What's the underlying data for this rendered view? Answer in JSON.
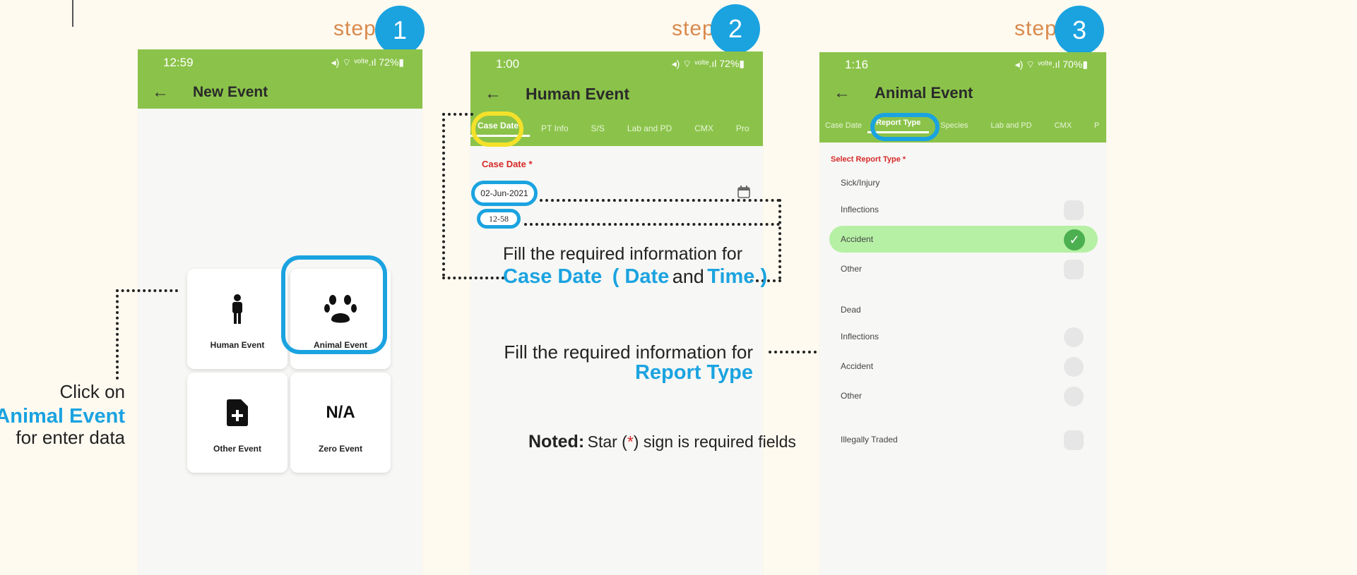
{
  "steps": [
    {
      "word": "step",
      "num": "1"
    },
    {
      "word": "step",
      "num": "2"
    },
    {
      "word": "step",
      "num": "3"
    }
  ],
  "phone1": {
    "time": "12:59",
    "status_right": "◂) ⌔ ᵛᵒˡᵗᵉ.ıl 72%▮",
    "back": "←",
    "title": "New Event",
    "tiles": [
      {
        "label": "Human Event",
        "icon": "person-icon",
        "glyph": "🯅"
      },
      {
        "label": "Animal Event",
        "icon": "paw-icon",
        "glyph": "🐾"
      },
      {
        "label": "Other Event",
        "icon": "add-file-icon",
        "glyph": "📄"
      },
      {
        "label": "Zero Event",
        "icon": "na-icon",
        "glyph": "N/A"
      }
    ]
  },
  "phone2": {
    "time": "1:00",
    "status_right": "◂) ⌔ ᵛᵒˡᵗᵉ.ıl 72%▮",
    "back": "←",
    "title": "Human Event",
    "tabs": [
      "Case Date",
      "PT Info",
      "S/S",
      "Lab and PD",
      "CMX",
      "Pro"
    ],
    "field_label": "Case Date *",
    "date_value": "02-Jun-2021",
    "time_value": "12-58",
    "calendar_icon": "calendar-icon"
  },
  "phone3": {
    "time": "1:16",
    "status_right": "◂) ⌔ ᵛᵒˡᵗᵉ.ıl 70%▮",
    "back": "←",
    "title": "Animal Event",
    "tabs": [
      "Case Date",
      "Report Type",
      "Species",
      "Lab and PD",
      "CMX",
      "P"
    ],
    "field_label": "Select Report Type *",
    "items": [
      "Sick/Injury",
      "Inflections",
      "Accident",
      "Other",
      "Dead",
      "Inflections",
      "Accident",
      "Other",
      "Illegally Traded"
    ]
  },
  "annotations": {
    "click_on": "Click on",
    "animal_event": "Animal Event",
    "for_enter_data": "for enter data",
    "fill_required_1": "Fill the required information for",
    "case_date": "Case Date",
    "paren_open": "( Date",
    "and": "and",
    "time_close": "Time )",
    "fill_required_2": "Fill the required information for",
    "report_type": "Report Type",
    "noted_label": "Noted:",
    "noted_text_a": "Star (",
    "star": "*",
    "noted_text_b": ") sign  is required fields"
  },
  "colors": {
    "accent_blue": "#1ba3e0",
    "app_green": "#8bc34a",
    "highlight_yellow": "#f5e12a",
    "step_orange": "#d9894d",
    "required_red": "#d62929",
    "selected_green": "#b6f0a5"
  }
}
